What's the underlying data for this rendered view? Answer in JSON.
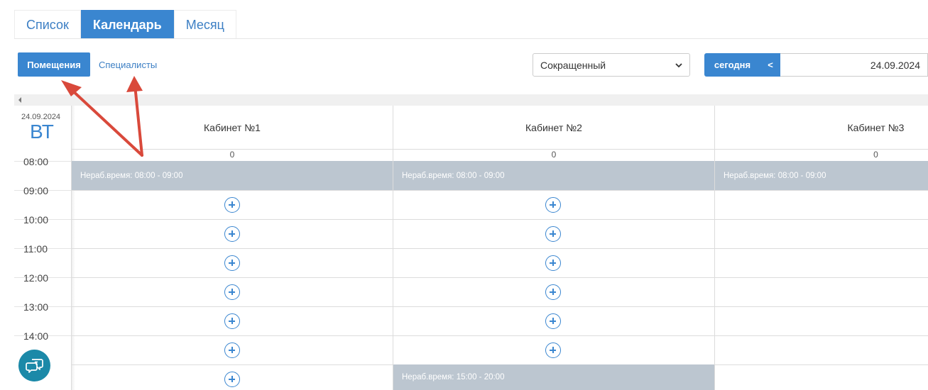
{
  "tabs": [
    {
      "label": "Список",
      "active": false
    },
    {
      "label": "Календарь",
      "active": true
    },
    {
      "label": "Месяц",
      "active": false
    }
  ],
  "toolbar": {
    "rooms_label": "Помещения",
    "specialists_label": "Специалисты",
    "view_select_value": "Сокращенный",
    "today_label": "сегодня",
    "prev_label": "<",
    "date_value": "24.09.2024"
  },
  "day": {
    "date": "24.09.2024",
    "weekday": "ВТ"
  },
  "times": [
    "08:00",
    "09:00",
    "10:00",
    "11:00",
    "12:00",
    "13:00",
    "14:00"
  ],
  "columns": [
    {
      "name": "Кабинет №1",
      "count": "0",
      "busy": "Нераб.время: 08:00 - 09:00"
    },
    {
      "name": "Кабинет №2",
      "count": "0",
      "busy": "Нераб.время: 08:00 - 09:00",
      "busy2": "Нераб.время: 15:00 - 20:00"
    },
    {
      "name": "Кабинет №3",
      "count": "0",
      "busy": "Нераб.время: 08:00 - 09:00"
    }
  ],
  "colors": {
    "accent": "#3a86d0",
    "busy": "#bcc6d0",
    "arrow": "#d9493b",
    "chat": "#1b89a8"
  }
}
